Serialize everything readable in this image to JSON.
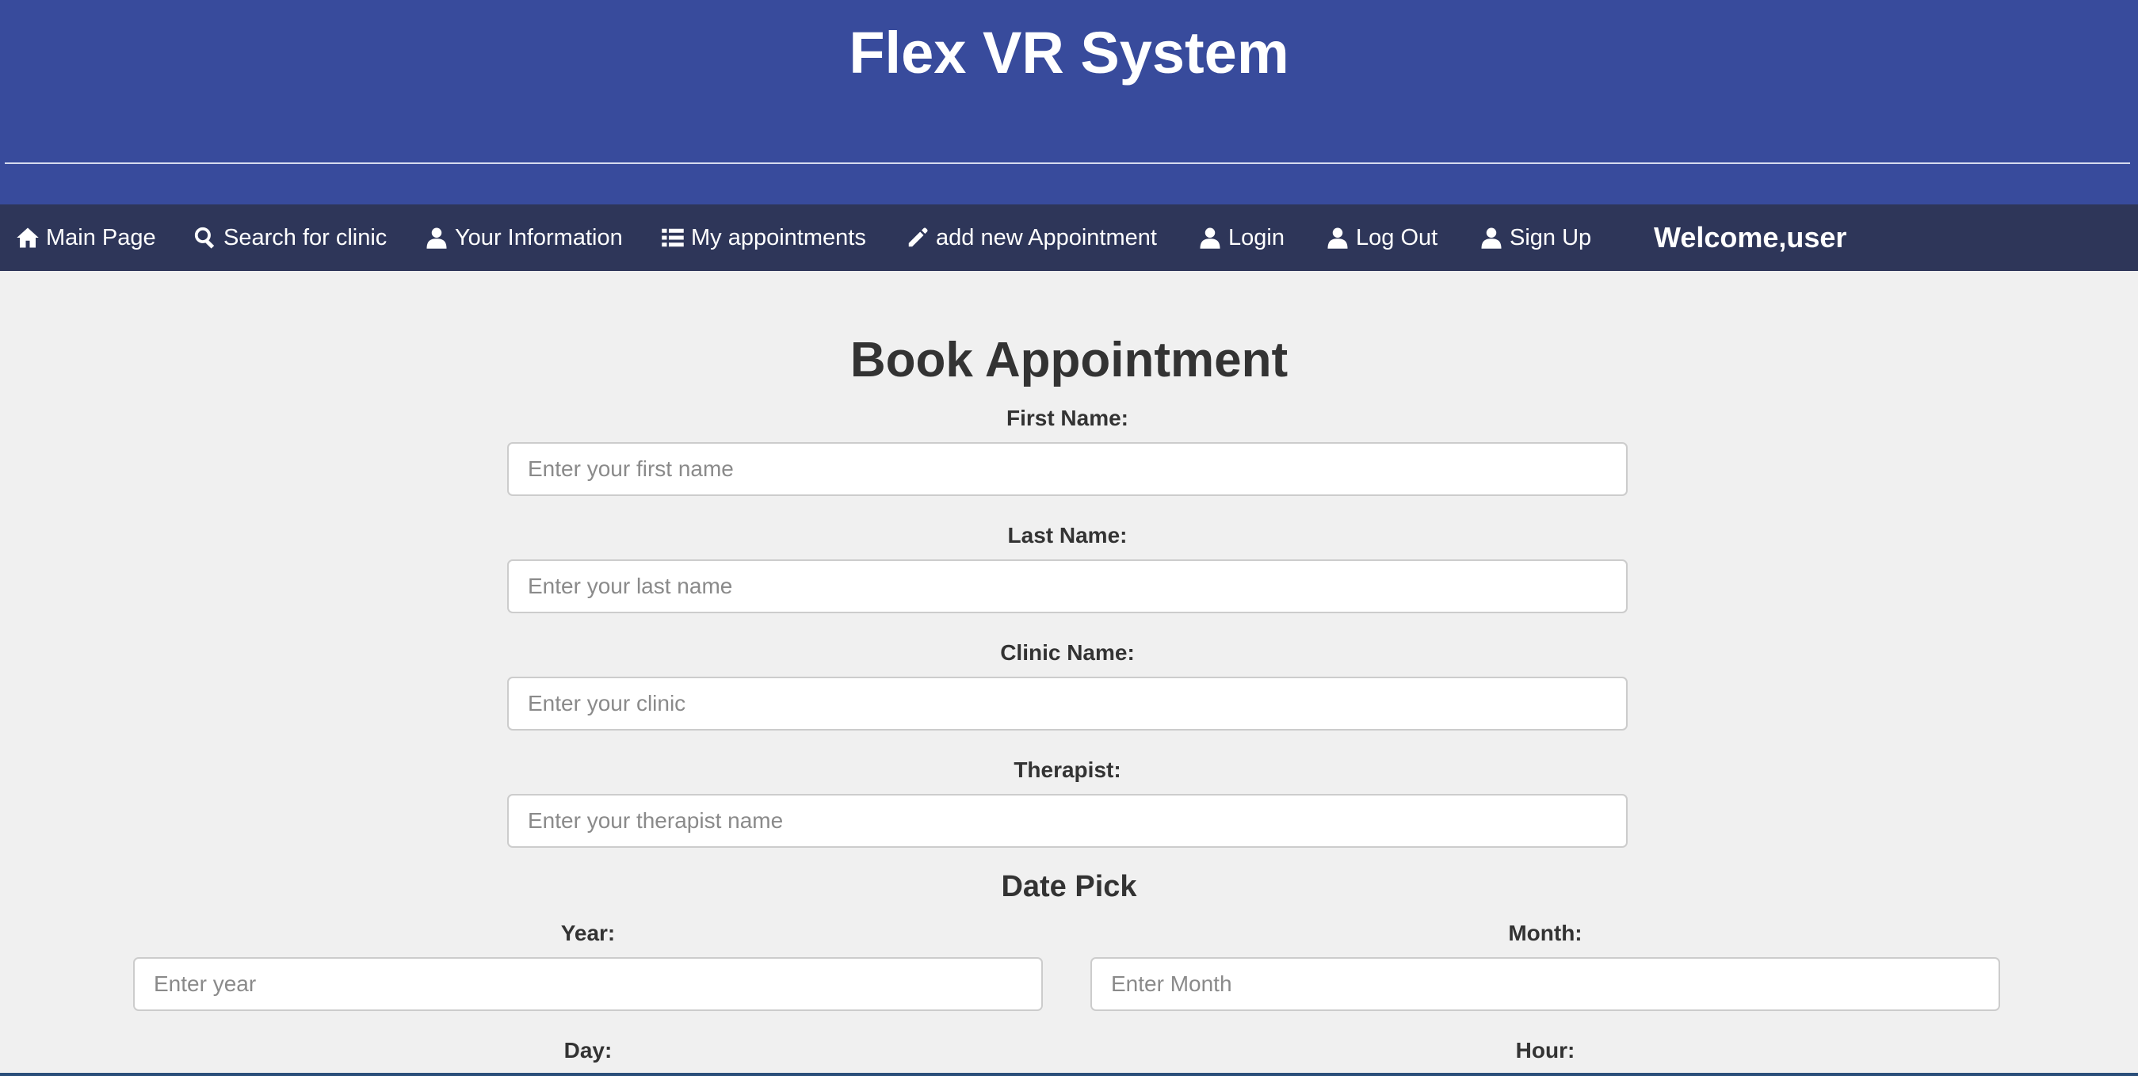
{
  "header": {
    "title": "Flex VR System"
  },
  "nav": {
    "items": [
      {
        "label": "Main Page",
        "icon": "home-icon"
      },
      {
        "label": "Search for clinic",
        "icon": "search-icon"
      },
      {
        "label": "Your Information",
        "icon": "user-icon"
      },
      {
        "label": "My appointments",
        "icon": "list-icon"
      },
      {
        "label": "add new Appointment",
        "icon": "pencil-icon"
      },
      {
        "label": "Login",
        "icon": "user-icon"
      },
      {
        "label": "Log Out",
        "icon": "user-icon"
      },
      {
        "label": "Sign Up",
        "icon": "user-icon"
      }
    ],
    "welcome": "Welcome,user"
  },
  "form": {
    "title": "Book Appointment",
    "first_name": {
      "label": "First Name:",
      "placeholder": "Enter your first name",
      "value": ""
    },
    "last_name": {
      "label": "Last Name:",
      "placeholder": "Enter your last name",
      "value": ""
    },
    "clinic_name": {
      "label": "Clinic Name:",
      "placeholder": "Enter your clinic",
      "value": ""
    },
    "therapist": {
      "label": "Therapist:",
      "placeholder": "Enter your therapist name",
      "value": ""
    },
    "date_section": "Date Pick",
    "year": {
      "label": "Year:",
      "placeholder": "Enter year",
      "value": ""
    },
    "month": {
      "label": "Month:",
      "placeholder": "Enter Month",
      "value": ""
    },
    "day": {
      "label": "Day:"
    },
    "hour": {
      "label": "Hour:"
    }
  },
  "colors": {
    "header_bg": "#384b9c",
    "navbar_bg": "#2e3659",
    "page_bg": "#f0f0f0"
  }
}
